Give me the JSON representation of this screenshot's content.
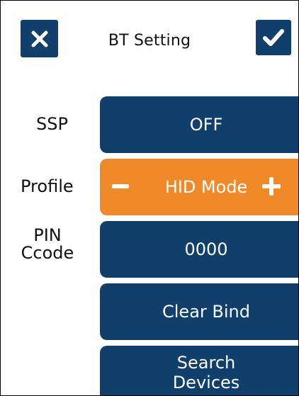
{
  "header": {
    "title": "BT Setting",
    "close_icon": "close-icon",
    "confirm_icon": "check-icon"
  },
  "rows": {
    "ssp": {
      "label": "SSP",
      "value": "OFF"
    },
    "profile": {
      "label": "Profile",
      "value": "HID Mode"
    },
    "pin": {
      "label_line1": "PIN",
      "label_line2": "Ccode",
      "value": "0000"
    }
  },
  "buttons": {
    "clear_bind": "Clear Bind",
    "search_line1": "Search",
    "search_line2": "Devices"
  },
  "colors": {
    "primary": "#113f6c",
    "accent": "#f08a29"
  }
}
